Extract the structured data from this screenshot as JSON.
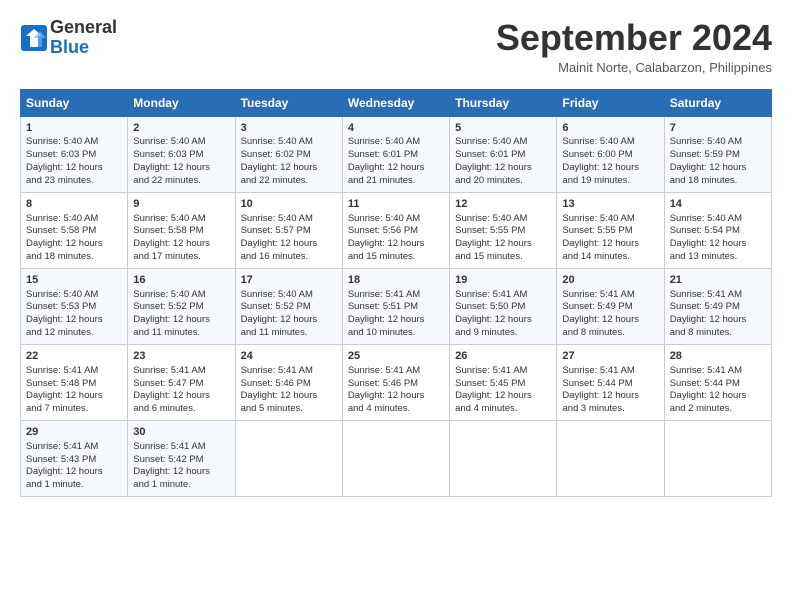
{
  "logo": {
    "line1": "General",
    "line2": "Blue"
  },
  "title": "September 2024",
  "location": "Mainit Norte, Calabarzon, Philippines",
  "days_of_week": [
    "Sunday",
    "Monday",
    "Tuesday",
    "Wednesday",
    "Thursday",
    "Friday",
    "Saturday"
  ],
  "weeks": [
    [
      {
        "day": "1",
        "lines": [
          "Sunrise: 5:40 AM",
          "Sunset: 6:03 PM",
          "Daylight: 12 hours",
          "and 23 minutes."
        ]
      },
      {
        "day": "2",
        "lines": [
          "Sunrise: 5:40 AM",
          "Sunset: 6:03 PM",
          "Daylight: 12 hours",
          "and 22 minutes."
        ]
      },
      {
        "day": "3",
        "lines": [
          "Sunrise: 5:40 AM",
          "Sunset: 6:02 PM",
          "Daylight: 12 hours",
          "and 22 minutes."
        ]
      },
      {
        "day": "4",
        "lines": [
          "Sunrise: 5:40 AM",
          "Sunset: 6:01 PM",
          "Daylight: 12 hours",
          "and 21 minutes."
        ]
      },
      {
        "day": "5",
        "lines": [
          "Sunrise: 5:40 AM",
          "Sunset: 6:01 PM",
          "Daylight: 12 hours",
          "and 20 minutes."
        ]
      },
      {
        "day": "6",
        "lines": [
          "Sunrise: 5:40 AM",
          "Sunset: 6:00 PM",
          "Daylight: 12 hours",
          "and 19 minutes."
        ]
      },
      {
        "day": "7",
        "lines": [
          "Sunrise: 5:40 AM",
          "Sunset: 5:59 PM",
          "Daylight: 12 hours",
          "and 18 minutes."
        ]
      }
    ],
    [
      {
        "day": "8",
        "lines": [
          "Sunrise: 5:40 AM",
          "Sunset: 5:58 PM",
          "Daylight: 12 hours",
          "and 18 minutes."
        ]
      },
      {
        "day": "9",
        "lines": [
          "Sunrise: 5:40 AM",
          "Sunset: 5:58 PM",
          "Daylight: 12 hours",
          "and 17 minutes."
        ]
      },
      {
        "day": "10",
        "lines": [
          "Sunrise: 5:40 AM",
          "Sunset: 5:57 PM",
          "Daylight: 12 hours",
          "and 16 minutes."
        ]
      },
      {
        "day": "11",
        "lines": [
          "Sunrise: 5:40 AM",
          "Sunset: 5:56 PM",
          "Daylight: 12 hours",
          "and 15 minutes."
        ]
      },
      {
        "day": "12",
        "lines": [
          "Sunrise: 5:40 AM",
          "Sunset: 5:55 PM",
          "Daylight: 12 hours",
          "and 15 minutes."
        ]
      },
      {
        "day": "13",
        "lines": [
          "Sunrise: 5:40 AM",
          "Sunset: 5:55 PM",
          "Daylight: 12 hours",
          "and 14 minutes."
        ]
      },
      {
        "day": "14",
        "lines": [
          "Sunrise: 5:40 AM",
          "Sunset: 5:54 PM",
          "Daylight: 12 hours",
          "and 13 minutes."
        ]
      }
    ],
    [
      {
        "day": "15",
        "lines": [
          "Sunrise: 5:40 AM",
          "Sunset: 5:53 PM",
          "Daylight: 12 hours",
          "and 12 minutes."
        ]
      },
      {
        "day": "16",
        "lines": [
          "Sunrise: 5:40 AM",
          "Sunset: 5:52 PM",
          "Daylight: 12 hours",
          "and 11 minutes."
        ]
      },
      {
        "day": "17",
        "lines": [
          "Sunrise: 5:40 AM",
          "Sunset: 5:52 PM",
          "Daylight: 12 hours",
          "and 11 minutes."
        ]
      },
      {
        "day": "18",
        "lines": [
          "Sunrise: 5:41 AM",
          "Sunset: 5:51 PM",
          "Daylight: 12 hours",
          "and 10 minutes."
        ]
      },
      {
        "day": "19",
        "lines": [
          "Sunrise: 5:41 AM",
          "Sunset: 5:50 PM",
          "Daylight: 12 hours",
          "and 9 minutes."
        ]
      },
      {
        "day": "20",
        "lines": [
          "Sunrise: 5:41 AM",
          "Sunset: 5:49 PM",
          "Daylight: 12 hours",
          "and 8 minutes."
        ]
      },
      {
        "day": "21",
        "lines": [
          "Sunrise: 5:41 AM",
          "Sunset: 5:49 PM",
          "Daylight: 12 hours",
          "and 8 minutes."
        ]
      }
    ],
    [
      {
        "day": "22",
        "lines": [
          "Sunrise: 5:41 AM",
          "Sunset: 5:48 PM",
          "Daylight: 12 hours",
          "and 7 minutes."
        ]
      },
      {
        "day": "23",
        "lines": [
          "Sunrise: 5:41 AM",
          "Sunset: 5:47 PM",
          "Daylight: 12 hours",
          "and 6 minutes."
        ]
      },
      {
        "day": "24",
        "lines": [
          "Sunrise: 5:41 AM",
          "Sunset: 5:46 PM",
          "Daylight: 12 hours",
          "and 5 minutes."
        ]
      },
      {
        "day": "25",
        "lines": [
          "Sunrise: 5:41 AM",
          "Sunset: 5:46 PM",
          "Daylight: 12 hours",
          "and 4 minutes."
        ]
      },
      {
        "day": "26",
        "lines": [
          "Sunrise: 5:41 AM",
          "Sunset: 5:45 PM",
          "Daylight: 12 hours",
          "and 4 minutes."
        ]
      },
      {
        "day": "27",
        "lines": [
          "Sunrise: 5:41 AM",
          "Sunset: 5:44 PM",
          "Daylight: 12 hours",
          "and 3 minutes."
        ]
      },
      {
        "day": "28",
        "lines": [
          "Sunrise: 5:41 AM",
          "Sunset: 5:44 PM",
          "Daylight: 12 hours",
          "and 2 minutes."
        ]
      }
    ],
    [
      {
        "day": "29",
        "lines": [
          "Sunrise: 5:41 AM",
          "Sunset: 5:43 PM",
          "Daylight: 12 hours",
          "and 1 minute."
        ]
      },
      {
        "day": "30",
        "lines": [
          "Sunrise: 5:41 AM",
          "Sunset: 5:42 PM",
          "Daylight: 12 hours",
          "and 1 minute."
        ]
      },
      null,
      null,
      null,
      null,
      null
    ]
  ]
}
